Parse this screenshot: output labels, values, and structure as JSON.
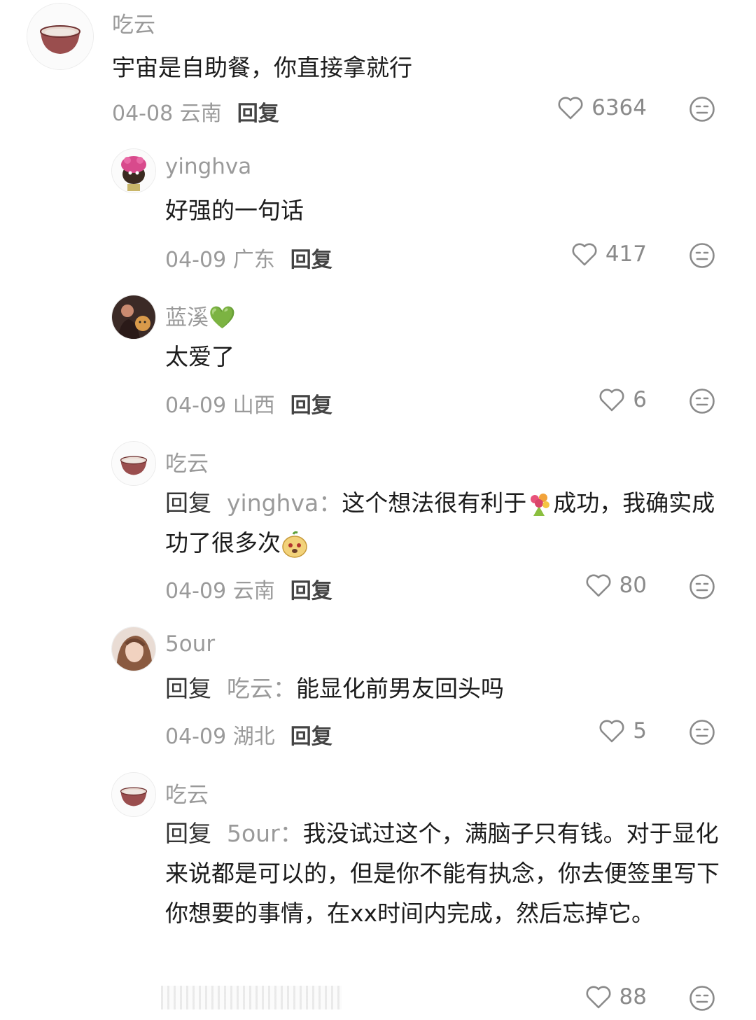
{
  "comments": [
    {
      "user": "吃云",
      "text": "宇宙是自助餐，你直接拿就行",
      "date": "04-08 云南",
      "reply_label": "回复",
      "likes": "6364"
    },
    {
      "user": "yinghva",
      "text": "好强的一句话",
      "date": "04-09 广东",
      "reply_label": "回复",
      "likes": "417"
    },
    {
      "user": "蓝溪💚",
      "text": "太爱了",
      "date": "04-09 山西",
      "reply_label": "回复",
      "likes": "6"
    },
    {
      "user": "吃云",
      "reply_prefix": "回复",
      "reply_to": "yinghva：",
      "text_a": "这个想法很有利于",
      "text_b": "成功，我确实成功了很多次",
      "date": "04-09 云南",
      "reply_label": "回复",
      "likes": "80"
    },
    {
      "user": "5our",
      "reply_prefix": "回复",
      "reply_to": "吃云：",
      "text": "能显化前男友回头吗",
      "date": "04-09 湖北",
      "reply_label": "回复",
      "likes": "5"
    },
    {
      "user": "吃云",
      "reply_prefix": "回复",
      "reply_to": "5our：",
      "text": "我没试过这个，满脑子只有钱。对于显化来说都是可以的，但是你不能有执念，你去便签里写下你想要的事情，在xx时间内完成，然后忘掉它。",
      "likes": "88"
    }
  ]
}
